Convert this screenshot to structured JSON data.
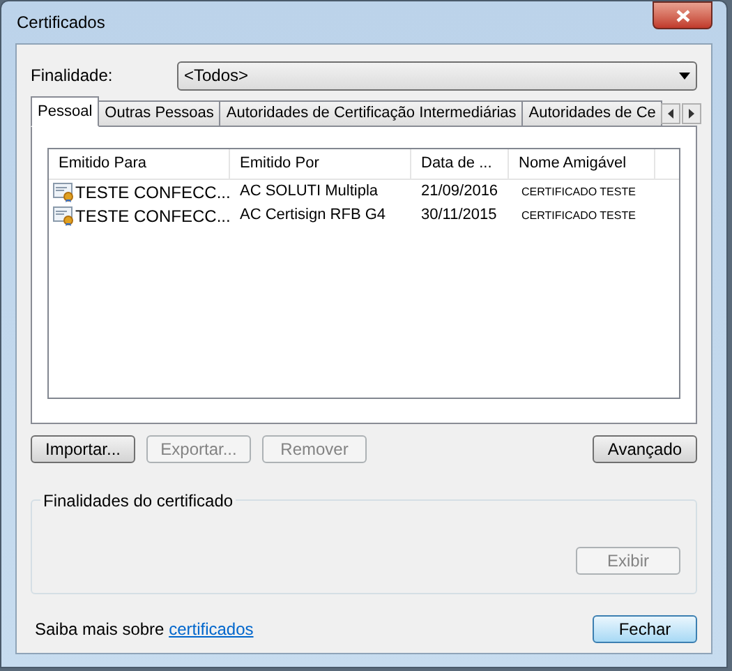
{
  "window": {
    "title": "Certificados"
  },
  "purpose": {
    "label": "Finalidade:",
    "value": "<Todos>"
  },
  "tabs": [
    {
      "label": "Pessoal",
      "selected": true
    },
    {
      "label": "Outras Pessoas",
      "selected": false
    },
    {
      "label": "Autoridades de Certificação Intermediárias",
      "selected": false
    },
    {
      "label": "Autoridades de Ce",
      "selected": false
    }
  ],
  "table": {
    "columns": [
      "Emitido Para",
      "Emitido Por",
      "Data de ...",
      "Nome Amigável"
    ],
    "rows": [
      {
        "issued_to": "TESTE CONFECC...",
        "issued_by": "AC SOLUTI Multipla",
        "date": "21/09/2016",
        "friendly_name": "CERTIFICADO TESTE"
      },
      {
        "issued_to": "TESTE CONFECC...",
        "issued_by": "AC Certisign RFB G4",
        "date": "30/11/2015",
        "friendly_name": "CERTIFICADO TESTE"
      }
    ]
  },
  "actions": [
    {
      "label": "Importar...",
      "disabled": false
    },
    {
      "label": "Exportar...",
      "disabled": true
    },
    {
      "label": "Remover",
      "disabled": true
    }
  ],
  "advanced_button": {
    "label": "Avançado",
    "disabled": false
  },
  "purposes_group": {
    "title": "Finalidades do certificado",
    "view_button": {
      "label": "Exibir",
      "disabled": true
    }
  },
  "footer": {
    "text": "Saiba mais sobre",
    "link": "certificados",
    "close_button": {
      "label": "Fechar",
      "default": true
    }
  }
}
